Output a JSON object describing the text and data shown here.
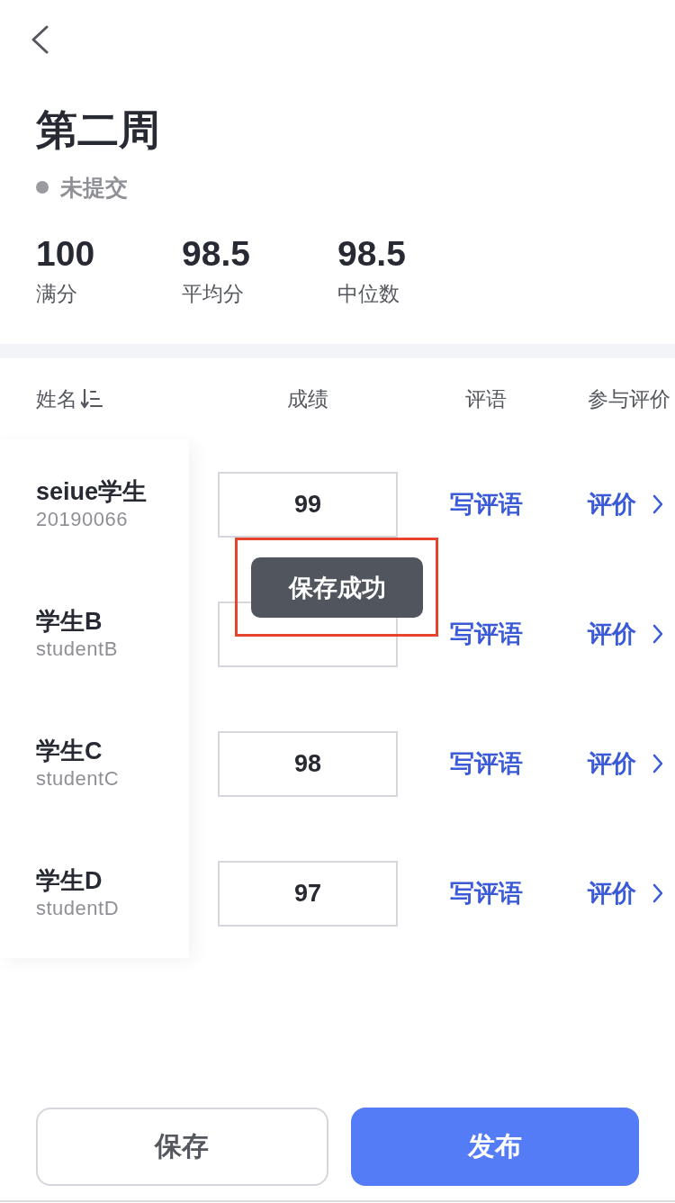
{
  "title": "第二周",
  "status": {
    "label": "未提交",
    "submitted": false
  },
  "stats": [
    {
      "value": "100",
      "label": "满分"
    },
    {
      "value": "98.5",
      "label": "平均分"
    },
    {
      "value": "98.5",
      "label": "中位数"
    }
  ],
  "table": {
    "columns": [
      {
        "label": "姓名",
        "sortable": true
      },
      {
        "label": "成绩",
        "sortable": false
      },
      {
        "label": "评语",
        "sortable": false
      },
      {
        "label": "参与评价",
        "sortable": false
      }
    ],
    "rows": [
      {
        "name": "seiue学生",
        "id": "20190066",
        "score": "99",
        "comment_link": "写评语",
        "evaluate_link": "评价"
      },
      {
        "name": "学生B",
        "id": "studentB",
        "comment_link": "写评语",
        "evaluate_link": "评价"
      },
      {
        "name": "学生C",
        "id": "studentC",
        "score": "98",
        "comment_link": "写评语",
        "evaluate_link": "评价"
      },
      {
        "name": "学生D",
        "id": "studentD",
        "score": "97",
        "comment_link": "写评语",
        "evaluate_link": "评价"
      }
    ]
  },
  "toast": {
    "text": "保存成功",
    "highlighted": true
  },
  "buttons": [
    {
      "label": "保存",
      "kind": "secondary"
    },
    {
      "label": "发布",
      "kind": "primary"
    }
  ]
}
